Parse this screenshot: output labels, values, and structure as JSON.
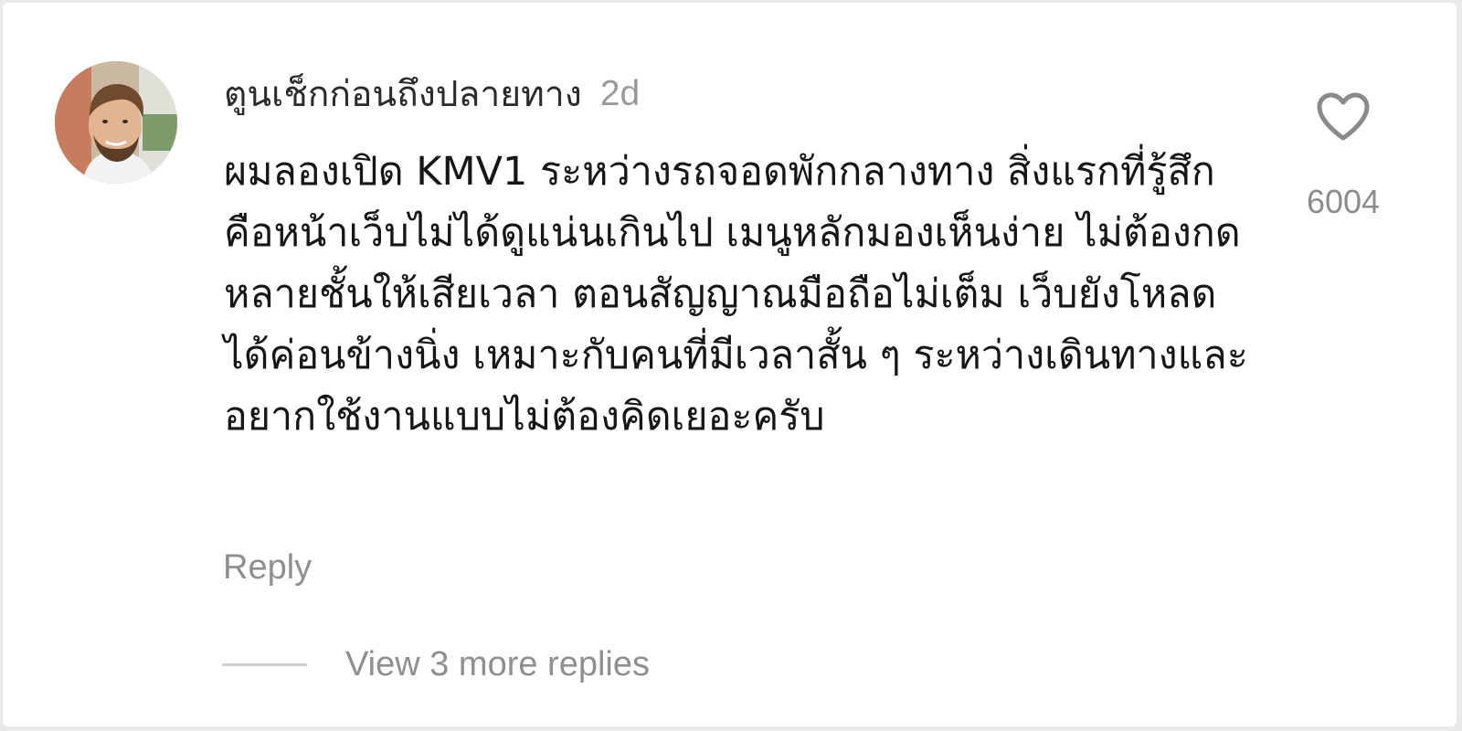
{
  "comment": {
    "username": "ตูนเช็กก่อนถึงปลายทาง",
    "time": "2d",
    "text": "ผมลองเปิด KMV1 ระหว่างรถจอดพักกลางทาง สิ่งแรกที่รู้สึกคือหน้าเว็บไม่ได้ดูแน่นเกินไป เมนูหลักมองเห็นง่าย ไม่ต้องกดหลายชั้นให้เสียเวลา ตอนสัญญาณมือถือไม่เต็ม เว็บยังโหลดได้ค่อนข้างนิ่ง เหมาะกับคนที่มีเวลาสั้น ๆ ระหว่างเดินทางและอยากใช้งานแบบไม่ต้องคิดเยอะครับ",
    "reply_label": "Reply",
    "like_count": "6004",
    "view_replies_label": "View 3 more replies"
  },
  "icons": {
    "like": "heart-outline-icon",
    "avatar": "user-avatar"
  },
  "colors": {
    "background": "#ffffff",
    "primary_text": "#161616",
    "secondary_text": "#8f8f8f",
    "icon": "#8a8a8a"
  }
}
